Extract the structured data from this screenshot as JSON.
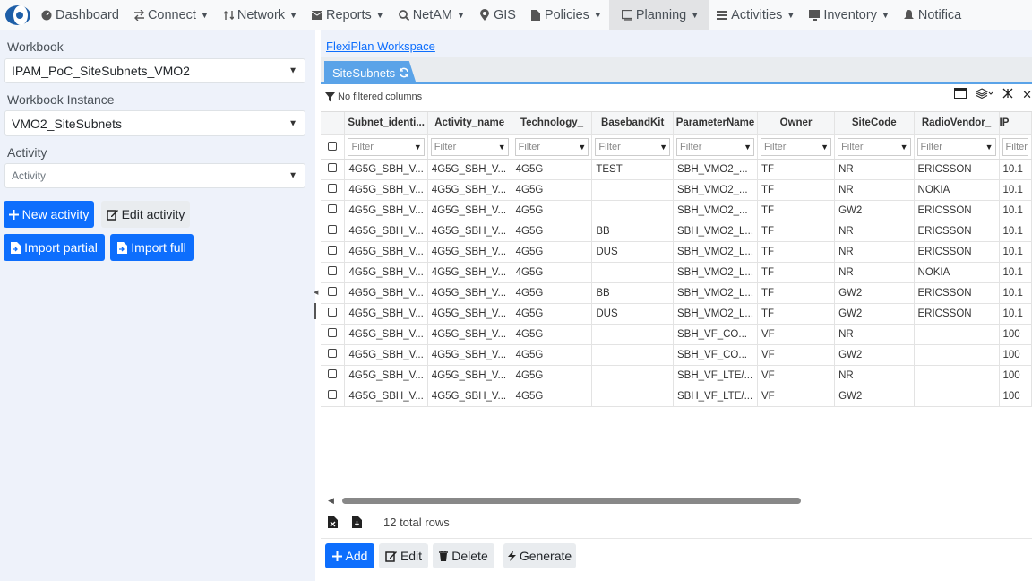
{
  "nav": {
    "items": [
      {
        "label": "Dashboard",
        "icon": "dashboard-icon",
        "caret": false
      },
      {
        "label": "Connect",
        "icon": "swap-icon",
        "caret": true
      },
      {
        "label": "Network",
        "icon": "network-icon",
        "caret": true
      },
      {
        "label": "Reports",
        "icon": "envelope-icon",
        "caret": true
      },
      {
        "label": "NetAM",
        "icon": "search-icon",
        "caret": true
      },
      {
        "label": "GIS",
        "icon": "map-pin-icon",
        "caret": false
      },
      {
        "label": "Policies",
        "icon": "document-icon",
        "caret": true
      },
      {
        "label": "Planning",
        "icon": "planning-icon",
        "caret": true,
        "active": true
      },
      {
        "label": "Activities",
        "icon": "list-icon",
        "caret": true
      },
      {
        "label": "Inventory",
        "icon": "monitor-icon",
        "caret": true
      },
      {
        "label": "Notifica",
        "icon": "bell-icon",
        "caret": false
      }
    ]
  },
  "left": {
    "workbook_label": "Workbook",
    "workbook_value": "IPAM_PoC_SiteSubnets_VMO2",
    "instance_label": "Workbook Instance",
    "instance_value": "VMO2_SiteSubnets",
    "activity_label": "Activity",
    "activity_placeholder": "Activity",
    "new_activity": "New activity",
    "edit_activity": "Edit activity",
    "import_partial": "Import partial",
    "import_full": "Import full"
  },
  "workspace": {
    "link": "FlexiPlan Workspace",
    "tab": "SiteSubnets",
    "filter_status": "No filtered columns",
    "filter_placeholder": "Filter",
    "columns": [
      "Subnet_identi...",
      "Activity_name",
      "Technology_",
      "BasebandKit",
      "ParameterName",
      "Owner",
      "SiteCode",
      "RadioVendor_",
      "IP"
    ],
    "rows": [
      [
        "4G5G_SBH_V...",
        "4G5G_SBH_V...",
        "4G5G",
        "TEST",
        "SBH_VMO2_...",
        "TF",
        "NR",
        "ERICSSON",
        "10.1"
      ],
      [
        "4G5G_SBH_V...",
        "4G5G_SBH_V...",
        "4G5G",
        "",
        "SBH_VMO2_...",
        "TF",
        "NR",
        "NOKIA",
        "10.1"
      ],
      [
        "4G5G_SBH_V...",
        "4G5G_SBH_V...",
        "4G5G",
        "",
        "SBH_VMO2_...",
        "TF",
        "GW2",
        "ERICSSON",
        "10.1"
      ],
      [
        "4G5G_SBH_V...",
        "4G5G_SBH_V...",
        "4G5G",
        "BB",
        "SBH_VMO2_L...",
        "TF",
        "NR",
        "ERICSSON",
        "10.1"
      ],
      [
        "4G5G_SBH_V...",
        "4G5G_SBH_V...",
        "4G5G",
        "DUS",
        "SBH_VMO2_L...",
        "TF",
        "NR",
        "ERICSSON",
        "10.1"
      ],
      [
        "4G5G_SBH_V...",
        "4G5G_SBH_V...",
        "4G5G",
        "",
        "SBH_VMO2_L...",
        "TF",
        "NR",
        "NOKIA",
        "10.1"
      ],
      [
        "4G5G_SBH_V...",
        "4G5G_SBH_V...",
        "4G5G",
        "BB",
        "SBH_VMO2_L...",
        "TF",
        "GW2",
        "ERICSSON",
        "10.1"
      ],
      [
        "4G5G_SBH_V...",
        "4G5G_SBH_V...",
        "4G5G",
        "DUS",
        "SBH_VMO2_L...",
        "TF",
        "GW2",
        "ERICSSON",
        "10.1"
      ],
      [
        "4G5G_SBH_V...",
        "4G5G_SBH_V...",
        "4G5G",
        "",
        "SBH_VF_CO...",
        "VF",
        "NR",
        "",
        "100"
      ],
      [
        "4G5G_SBH_V...",
        "4G5G_SBH_V...",
        "4G5G",
        "",
        "SBH_VF_CO...",
        "VF",
        "GW2",
        "",
        "100"
      ],
      [
        "4G5G_SBH_V...",
        "4G5G_SBH_V...",
        "4G5G",
        "",
        "SBH_VF_LTE/...",
        "VF",
        "NR",
        "",
        "100"
      ],
      [
        "4G5G_SBH_V...",
        "4G5G_SBH_V...",
        "4G5G",
        "",
        "SBH_VF_LTE/...",
        "VF",
        "GW2",
        "",
        "100"
      ]
    ],
    "total_rows": "12 total rows",
    "add": "Add",
    "edit": "Edit",
    "delete": "Delete",
    "generate": "Generate"
  }
}
